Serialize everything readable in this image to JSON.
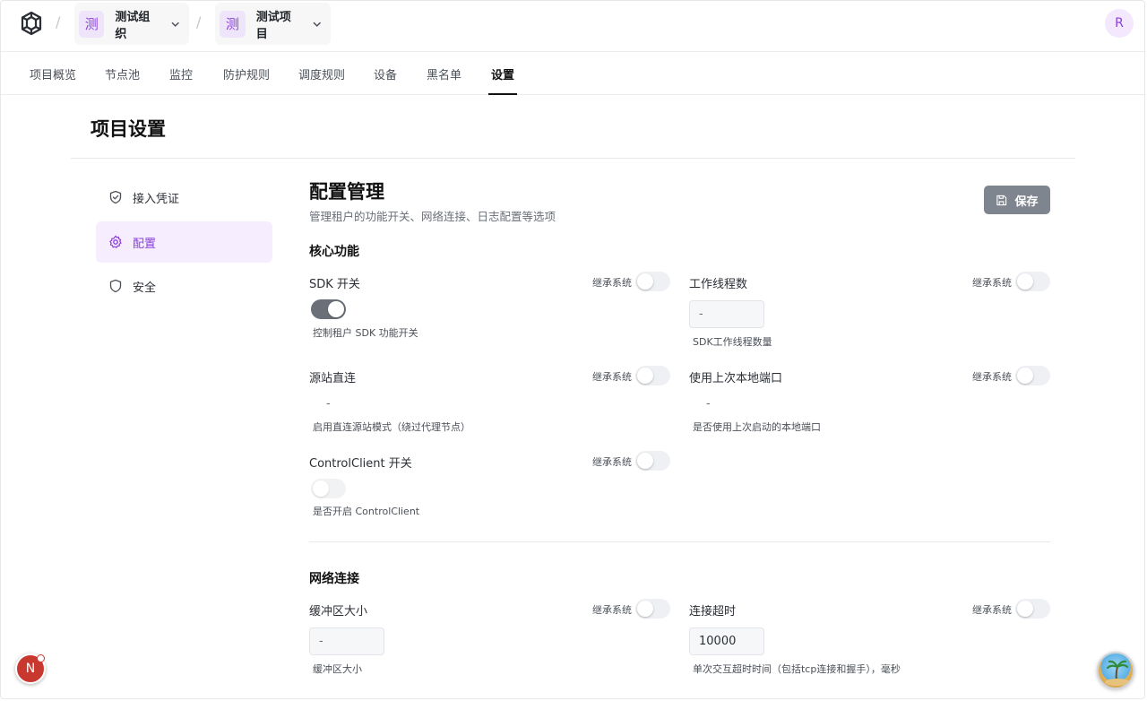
{
  "breadcrumb": {
    "org": {
      "badge": "测",
      "name": "测试组织"
    },
    "project": {
      "badge": "测",
      "name": "测试项目"
    },
    "separator": "/"
  },
  "user": {
    "initial": "R"
  },
  "tabs": [
    {
      "label": "项目概览"
    },
    {
      "label": "节点池"
    },
    {
      "label": "监控"
    },
    {
      "label": "防护规则"
    },
    {
      "label": "调度规则"
    },
    {
      "label": "设备"
    },
    {
      "label": "黑名单"
    },
    {
      "label": "设置",
      "active": true
    }
  ],
  "page_title": "项目设置",
  "sidebar": {
    "items": [
      {
        "label": "接入凭证",
        "icon": "shield-check-icon"
      },
      {
        "label": "配置",
        "icon": "gear-icon",
        "active": true
      },
      {
        "label": "安全",
        "icon": "shield-icon"
      }
    ]
  },
  "content": {
    "title": "配置管理",
    "subtitle": "管理租户的功能开关、网络连接、日志配置等选项",
    "save_label": "保存"
  },
  "inherit_label": "继承系统",
  "sections": {
    "core": {
      "title": "核心功能",
      "sdk_switch": {
        "label": "SDK 开关",
        "help": "控制租户 SDK 功能开关",
        "value": true
      },
      "worker_threads": {
        "label": "工作线程数",
        "value": "-",
        "help": "SDK工作线程数量"
      },
      "origin_direct": {
        "label": "源站直连",
        "value": "-",
        "help": "启用直连源站模式（绕过代理节点）"
      },
      "last_local_port": {
        "label": "使用上次本地端口",
        "value": "-",
        "help": "是否使用上次启动的本地端口"
      },
      "control_client": {
        "label": "ControlClient 开关",
        "help": "是否开启 ControlClient",
        "value": false
      }
    },
    "network": {
      "title": "网络连接",
      "buffer_size": {
        "label": "缓冲区大小",
        "value": "-",
        "help": "缓冲区大小"
      },
      "connect_timeout": {
        "label": "连接超时",
        "value": "10000",
        "help": "单次交互超时时间（包括tcp连接和握手），毫秒"
      }
    }
  },
  "floating": {
    "notification_initial": "N"
  },
  "colors": {
    "accent": "#8b3fd9",
    "accent_bg": "#f6eefe",
    "save_bg": "#7f858e"
  }
}
